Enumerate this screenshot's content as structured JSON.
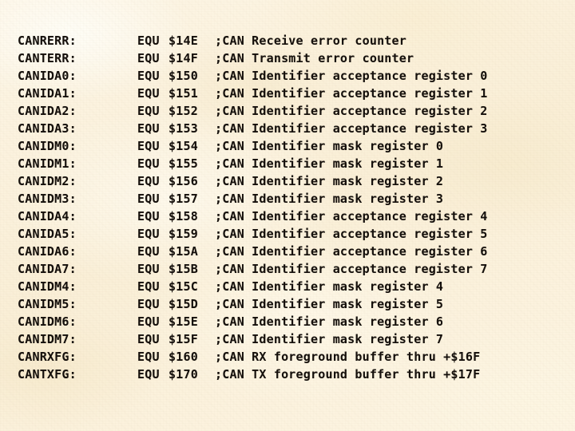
{
  "document": {
    "type": "assembly-source-listing",
    "background_color": "#fcf3de",
    "text_color": "#15100c",
    "mnemonic": "EQU",
    "comment_prefix": ";CAN",
    "lines": [
      {
        "label": "CANRERR:",
        "mnemonic": "EQU",
        "operand": "$14E",
        "comment": ";CAN Receive error counter"
      },
      {
        "label": "CANTERR:",
        "mnemonic": "EQU",
        "operand": "$14F",
        "comment": ";CAN Transmit error counter"
      },
      {
        "label": "CANIDA0:",
        "mnemonic": "EQU",
        "operand": "$150",
        "comment": ";CAN Identifier acceptance register 0"
      },
      {
        "label": "CANIDA1:",
        "mnemonic": "EQU",
        "operand": "$151",
        "comment": ";CAN Identifier acceptance register 1"
      },
      {
        "label": "CANIDA2:",
        "mnemonic": "EQU",
        "operand": "$152",
        "comment": ";CAN Identifier acceptance register 2"
      },
      {
        "label": "CANIDA3:",
        "mnemonic": "EQU",
        "operand": "$153",
        "comment": ";CAN Identifier acceptance register 3"
      },
      {
        "label": "CANIDM0:",
        "mnemonic": "EQU",
        "operand": "$154",
        "comment": ";CAN Identifier mask register 0"
      },
      {
        "label": "CANIDM1:",
        "mnemonic": "EQU",
        "operand": "$155",
        "comment": ";CAN Identifier mask register 1"
      },
      {
        "label": "CANIDM2:",
        "mnemonic": "EQU",
        "operand": "$156",
        "comment": ";CAN Identifier mask register 2"
      },
      {
        "label": "CANIDM3:",
        "mnemonic": "EQU",
        "operand": "$157",
        "comment": ";CAN Identifier mask register 3"
      },
      {
        "label": "CANIDA4:",
        "mnemonic": "EQU",
        "operand": "$158",
        "comment": ";CAN Identifier acceptance register 4"
      },
      {
        "label": "CANIDA5:",
        "mnemonic": "EQU",
        "operand": "$159",
        "comment": ";CAN Identifier acceptance register 5"
      },
      {
        "label": "CANIDA6:",
        "mnemonic": "EQU",
        "operand": "$15A",
        "comment": ";CAN Identifier acceptance register 6"
      },
      {
        "label": "CANIDA7:",
        "mnemonic": "EQU",
        "operand": "$15B",
        "comment": ";CAN Identifier acceptance register 7"
      },
      {
        "label": "CANIDM4:",
        "mnemonic": "EQU",
        "operand": "$15C",
        "comment": ";CAN Identifier mask register 4"
      },
      {
        "label": "CANIDM5:",
        "mnemonic": "EQU",
        "operand": "$15D",
        "comment": ";CAN Identifier mask register 5"
      },
      {
        "label": "CANIDM6:",
        "mnemonic": "EQU",
        "operand": "$15E",
        "comment": ";CAN Identifier mask register 6"
      },
      {
        "label": "CANIDM7:",
        "mnemonic": "EQU",
        "operand": "$15F",
        "comment": ";CAN Identifier mask register 7"
      },
      {
        "label": "CANRXFG:",
        "mnemonic": "EQU",
        "operand": "$160",
        "comment": ";CAN RX foreground buffer thru +$16F"
      },
      {
        "label": "CANTXFG:",
        "mnemonic": "EQU",
        "operand": "$170",
        "comment": ";CAN TX foreground buffer thru +$17F"
      }
    ]
  }
}
